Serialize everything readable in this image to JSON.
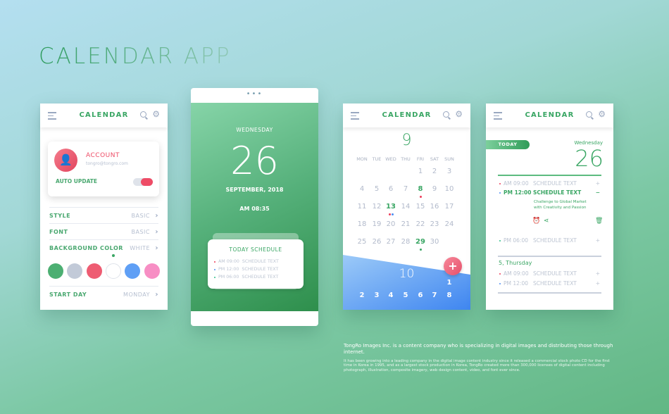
{
  "title": "CALENDAR APP",
  "header_title": "CALENDAR",
  "colors": {
    "green": "#3aa664",
    "red": "#ee5c72",
    "blue": "#4f8ff2"
  },
  "settings": {
    "account_label": "ACCOUNT",
    "account_email": "tongro@tongro.com",
    "auto_update_label": "AUTO UPDATE",
    "auto_update_on": true,
    "rows": [
      {
        "label": "STYLE",
        "value": "BASIC"
      },
      {
        "label": "FONT",
        "value": "BASIC"
      },
      {
        "label": "BACKGROUND COLOR",
        "value": "WHITE"
      },
      {
        "label": "START DAY",
        "value": "MONDAY"
      }
    ],
    "swatches": [
      "#4caf72",
      "#c2cad8",
      "#ee5c72",
      "#ffffff",
      "#5f9ff5",
      "#f78ec4"
    ],
    "selected_swatch": 3
  },
  "lock": {
    "weekday": "WEDNESDAY",
    "day": "26",
    "month_year": "SEPTEMBER, 2018",
    "time": "AM 08:35",
    "schedule_title": "TODAY SCHEDULE",
    "items": [
      {
        "time": "AM 09:00",
        "text": "SCHEDULE TEXT",
        "color": "#ee3c5a"
      },
      {
        "time": "PM 12:00",
        "text": "SCHEDULE TEXT",
        "color": "#4f8ff2"
      },
      {
        "time": "PM 06:00",
        "text": "SCHEDULE TEXT",
        "color": "#2fbf8a"
      }
    ]
  },
  "month": {
    "month": "9",
    "weekdays": [
      "MON",
      "TUE",
      "WED",
      "THU",
      "FRI",
      "SAT",
      "SUN"
    ],
    "days": [
      "",
      "",
      "",
      "",
      "1",
      "2",
      "3",
      "4",
      "5",
      "6",
      "7",
      "8",
      "9",
      "10",
      "11",
      "12",
      "13",
      "14",
      "15",
      "16",
      "17",
      "18",
      "19",
      "20",
      "21",
      "22",
      "23",
      "24",
      "25",
      "26",
      "27",
      "28",
      "29",
      "30",
      ""
    ],
    "highlighted": [
      "8",
      "13",
      "29"
    ],
    "next_month": "10",
    "next_days": [
      "1",
      "2",
      "3",
      "4",
      "5",
      "6",
      "7",
      "8"
    ],
    "add_label": "+"
  },
  "day": {
    "today_label": "TODAY",
    "weekday": "Wednesday",
    "day": "26",
    "items": [
      {
        "time": "AM 09:00",
        "text": "SCHEDULE TEXT",
        "color": "#ee3c5a",
        "toggle": "+"
      },
      {
        "time": "PM 12:00",
        "text": "SCHEDULE TEXT",
        "color": "#4f8ff2",
        "toggle": "−",
        "detail": "Challenge to Global Market with Creativity and Passion"
      },
      {
        "time": "PM 06:00",
        "text": "SCHEDULE TEXT",
        "color": "#2fbf8a",
        "toggle": "+"
      }
    ],
    "next_heading": "5, Thursday",
    "next_items": [
      {
        "time": "AM 09:00",
        "text": "SCHEDULE TEXT",
        "color": "#ee3c5a",
        "toggle": "+"
      },
      {
        "time": "PM 12:00",
        "text": "SCHEDULE TEXT",
        "color": "#4f8ff2",
        "toggle": "+"
      }
    ]
  },
  "footer": {
    "headline": "TongRo Images Inc. is a content company who is specializing in digital images and distributing those through internet.",
    "body": "It has been growing into a leading company in the digital image content industry since it released a commercial stock photo CD for the first time in Korea in 1995, and as a largest stock production in Korea, TongRo created more than 300,000 licenses of digital content including photograph, illustration, composite imagery, web design content, video, and font ever since."
  }
}
